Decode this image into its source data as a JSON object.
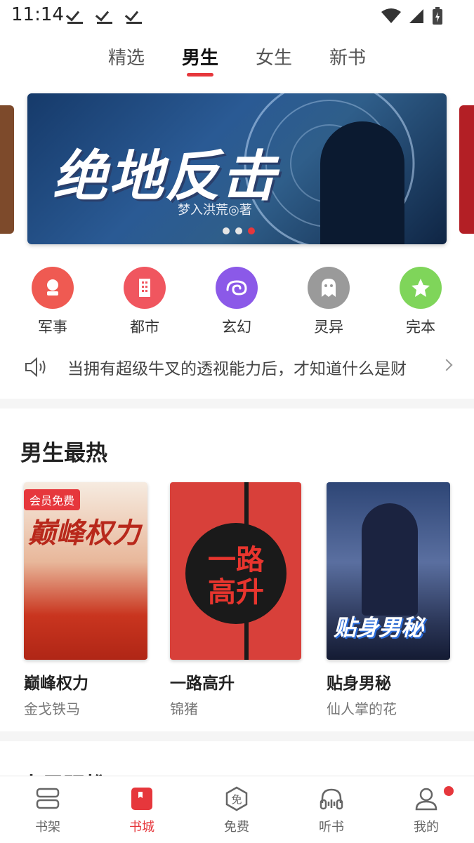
{
  "status_bar": {
    "time": "11:14"
  },
  "top_tabs": [
    {
      "label": "精选"
    },
    {
      "label": "男生"
    },
    {
      "label": "女生"
    },
    {
      "label": "新书"
    }
  ],
  "active_tab": "男生",
  "banner": {
    "title": "绝地反击",
    "author": "梦入洪荒◎著",
    "dot_count": 3,
    "active_dot": 3
  },
  "categories": [
    {
      "label": "军事",
      "icon": "medal-icon",
      "color": "#ef5a52"
    },
    {
      "label": "都市",
      "icon": "building-icon",
      "color": "#f0565f"
    },
    {
      "label": "玄幻",
      "icon": "swirl-icon",
      "color": "#8b59e8"
    },
    {
      "label": "灵异",
      "icon": "ghost-icon",
      "color": "#9a9a9a"
    },
    {
      "label": "完本",
      "icon": "star-icon",
      "color": "#7fd55a"
    }
  ],
  "notice": {
    "text": "当拥有超级牛叉的透视能力后，才知道什么是财"
  },
  "hot_section": {
    "title": "男生最热",
    "books": [
      {
        "title": "巅峰权力",
        "author": "金戈铁马",
        "badge": "会员免费",
        "cover_text": "巅峰权力"
      },
      {
        "title": "一路高升",
        "author": "锦猪",
        "badge": "",
        "cover_text": "一路高升"
      },
      {
        "title": "贴身男秘",
        "author": "仙人掌的花",
        "badge": "",
        "cover_text": "贴身男秘"
      }
    ]
  },
  "next_section": {
    "title": "大男强推"
  },
  "bottom_nav": [
    {
      "label": "书架",
      "icon": "bookshelf-icon"
    },
    {
      "label": "书城",
      "icon": "bookstore-icon"
    },
    {
      "label": "免费",
      "icon": "free-icon"
    },
    {
      "label": "听书",
      "icon": "headphones-icon"
    },
    {
      "label": "我的",
      "icon": "profile-icon"
    }
  ],
  "active_nav": "书城",
  "colors": {
    "accent": "#e6373c"
  }
}
